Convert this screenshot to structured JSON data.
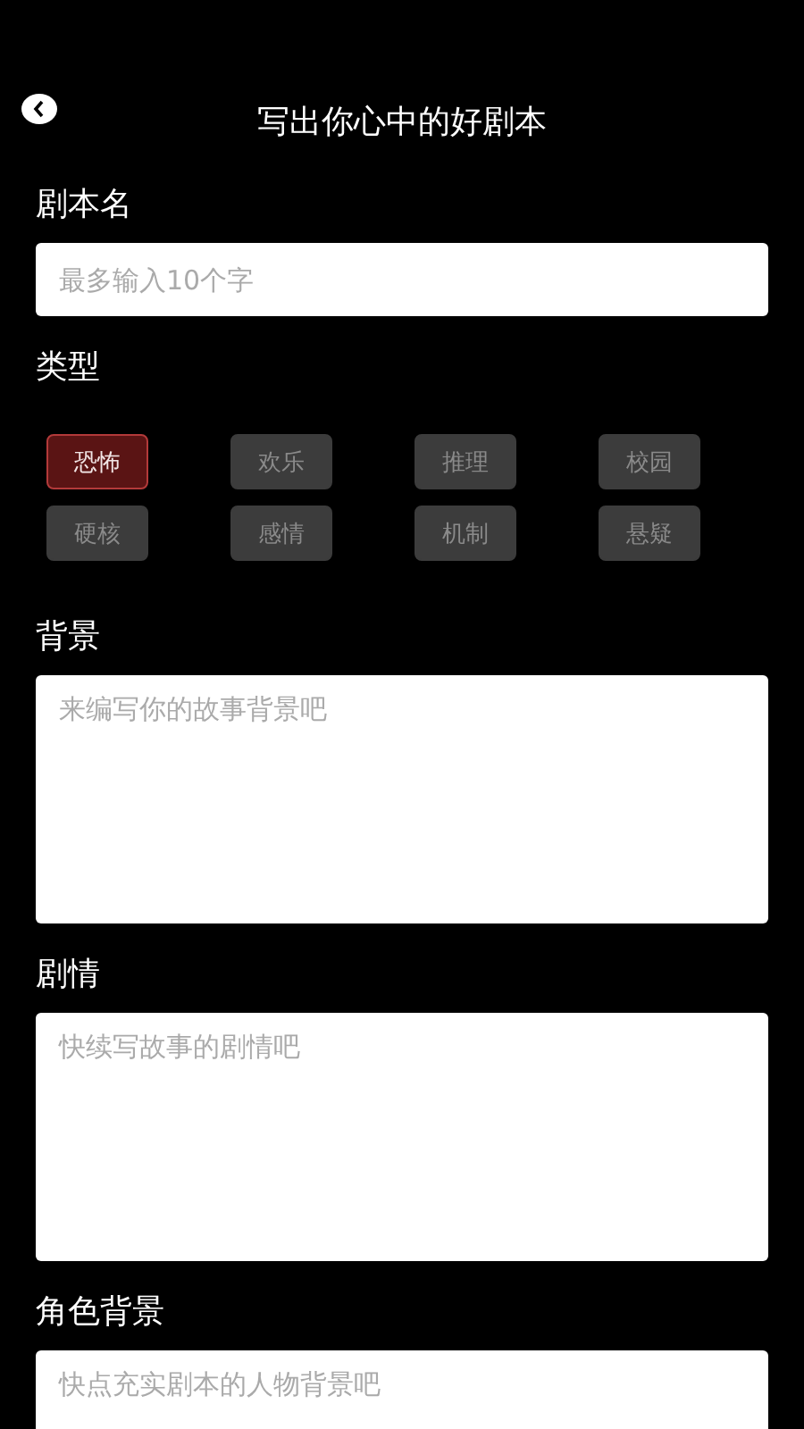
{
  "header": {
    "title": "写出你心中的好剧本"
  },
  "name_field": {
    "label": "剧本名",
    "placeholder": "最多输入10个字"
  },
  "genre": {
    "label": "类型",
    "tags": [
      {
        "label": "恐怖",
        "selected": true
      },
      {
        "label": "欢乐",
        "selected": false
      },
      {
        "label": "推理",
        "selected": false
      },
      {
        "label": "校园",
        "selected": false
      },
      {
        "label": "硬核",
        "selected": false
      },
      {
        "label": "感情",
        "selected": false
      },
      {
        "label": "机制",
        "selected": false
      },
      {
        "label": "悬疑",
        "selected": false
      }
    ]
  },
  "sections": [
    {
      "label": "背景",
      "placeholder": "来编写你的故事背景吧"
    },
    {
      "label": "剧情",
      "placeholder": "快续写故事的剧情吧"
    },
    {
      "label": "角色背景",
      "placeholder": "快点充实剧本的人物背景吧"
    }
  ]
}
